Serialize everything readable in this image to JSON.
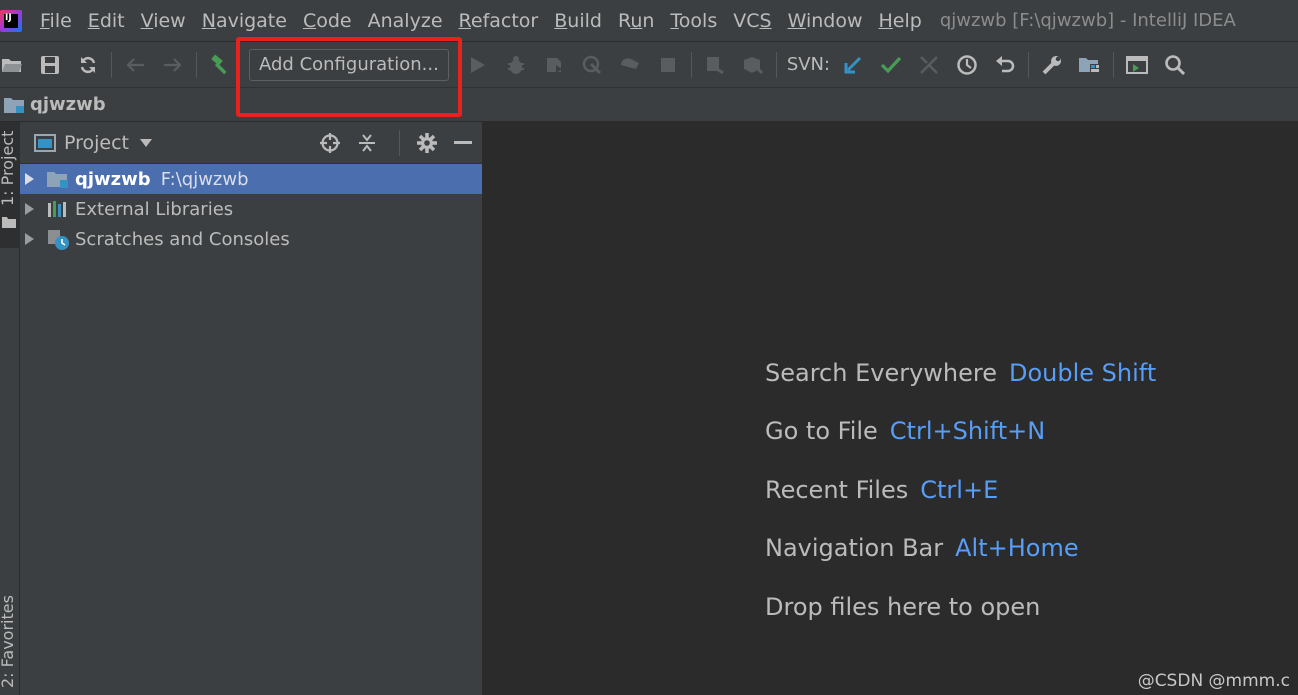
{
  "menu": {
    "items": [
      {
        "pre": "",
        "ul": "F",
        "post": "ile"
      },
      {
        "pre": "",
        "ul": "E",
        "post": "dit"
      },
      {
        "pre": "",
        "ul": "V",
        "post": "iew"
      },
      {
        "pre": "",
        "ul": "N",
        "post": "avigate"
      },
      {
        "pre": "",
        "ul": "C",
        "post": "ode"
      },
      {
        "pre": "Analy",
        "ul": "z",
        "post": "e"
      },
      {
        "pre": "",
        "ul": "R",
        "post": "efactor"
      },
      {
        "pre": "",
        "ul": "B",
        "post": "uild"
      },
      {
        "pre": "R",
        "ul": "u",
        "post": "n"
      },
      {
        "pre": "",
        "ul": "T",
        "post": "ools"
      },
      {
        "pre": "VC",
        "ul": "S",
        "post": ""
      },
      {
        "pre": "",
        "ul": "W",
        "post": "indow"
      },
      {
        "pre": "",
        "ul": "H",
        "post": "elp"
      }
    ],
    "window_title": "qjwzwb [F:\\qjwzwb] - IntelliJ IDEA"
  },
  "toolbar": {
    "config_label": "Add Configuration...",
    "svn_label": "SVN:"
  },
  "navbar": {
    "project_name": "qjwzwb"
  },
  "left_strip": {
    "project_tab": "1: Project",
    "favorites_tab": "2: Favorites"
  },
  "project_panel": {
    "title": "Project",
    "tree": [
      {
        "label": "qjwzwb",
        "path": "F:\\qjwzwb"
      },
      {
        "label": "External Libraries"
      },
      {
        "label": "Scratches and Consoles"
      }
    ]
  },
  "editor": {
    "hints": [
      {
        "action": "Search Everywhere",
        "shortcut": "Double Shift"
      },
      {
        "action": "Go to File",
        "shortcut": "Ctrl+Shift+N"
      },
      {
        "action": "Recent Files",
        "shortcut": "Ctrl+E"
      },
      {
        "action": "Navigation Bar",
        "shortcut": "Alt+Home"
      }
    ],
    "drop_text": "Drop files here to open"
  },
  "watermark": "@CSDN @mmm.c",
  "colors": {
    "selection": "#4b6eaf",
    "shortcut": "#589df6",
    "highlight": "#e8231d",
    "svn_update": "#3592c4",
    "svn_commit": "#499c54",
    "build": "#499c54"
  }
}
